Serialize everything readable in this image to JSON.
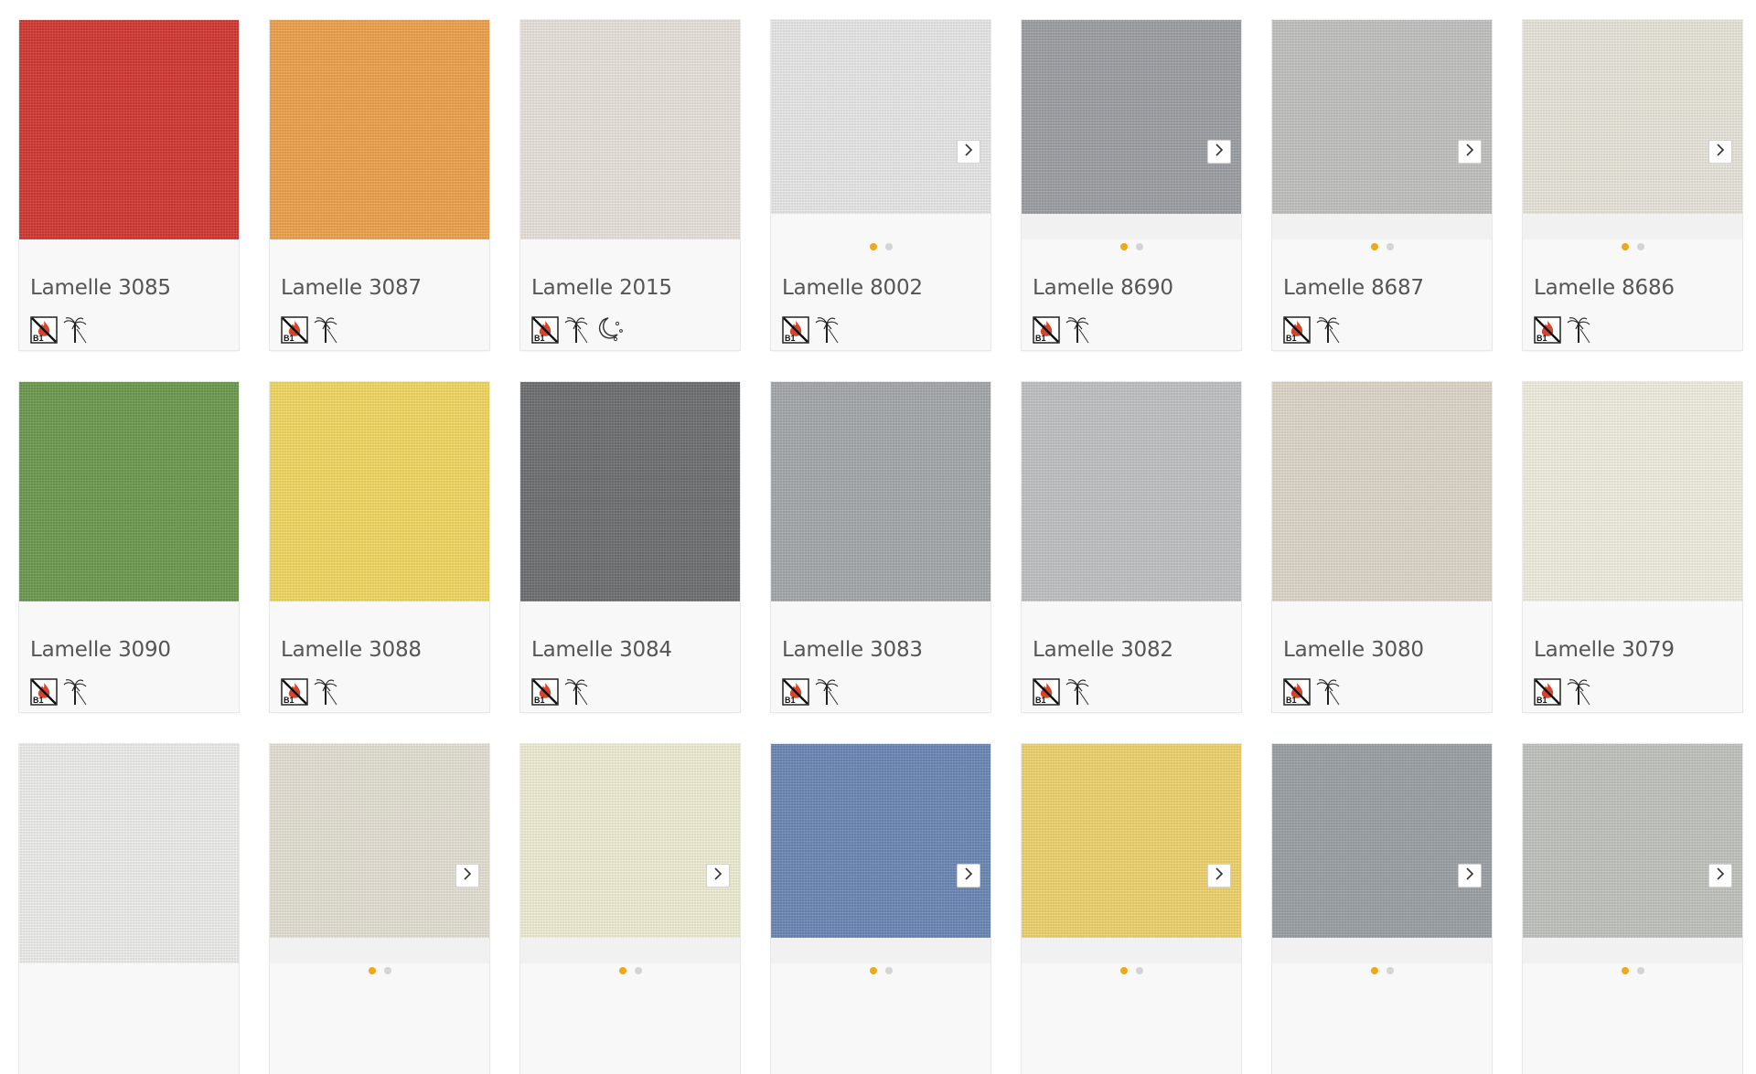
{
  "products": [
    {
      "name": "Lamelle 3085",
      "color": "#d53a33",
      "slider": false,
      "icons": [
        "fire-b1-icon",
        "palm-tree-icon"
      ]
    },
    {
      "name": "Lamelle 3087",
      "color": "#f0a44f",
      "slider": false,
      "icons": [
        "fire-b1-icon",
        "palm-tree-icon"
      ]
    },
    {
      "name": "Lamelle 2015",
      "color": "#ebe5de",
      "slider": false,
      "icons": [
        "fire-b1-icon",
        "palm-tree-icon",
        "moon-stars-icon"
      ]
    },
    {
      "name": "Lamelle 8002",
      "color": "#eaeaea",
      "slider": true,
      "icons": [
        "fire-b1-icon",
        "palm-tree-icon"
      ]
    },
    {
      "name": "Lamelle 8690",
      "color": "#9ea2a6",
      "slider": true,
      "icons": [
        "fire-b1-icon",
        "palm-tree-icon"
      ]
    },
    {
      "name": "Lamelle 8687",
      "color": "#c4c4c3",
      "slider": true,
      "icons": [
        "fire-b1-icon",
        "palm-tree-icon"
      ]
    },
    {
      "name": "Lamelle 8686",
      "color": "#ebe8dd",
      "slider": true,
      "icons": [
        "fire-b1-icon",
        "palm-tree-icon"
      ]
    },
    {
      "name": "Lamelle 3090",
      "color": "#6f9d52",
      "slider": false,
      "icons": [
        "fire-b1-icon",
        "palm-tree-icon"
      ]
    },
    {
      "name": "Lamelle 3088",
      "color": "#f5da64",
      "slider": false,
      "icons": [
        "fire-b1-icon",
        "palm-tree-icon"
      ]
    },
    {
      "name": "Lamelle 3084",
      "color": "#707274",
      "slider": false,
      "icons": [
        "fire-b1-icon",
        "palm-tree-icon"
      ]
    },
    {
      "name": "Lamelle 3083",
      "color": "#a7abae",
      "slider": false,
      "icons": [
        "fire-b1-icon",
        "palm-tree-icon"
      ]
    },
    {
      "name": "Lamelle 3082",
      "color": "#c3c4c5",
      "slider": false,
      "icons": [
        "fire-b1-icon",
        "palm-tree-icon"
      ]
    },
    {
      "name": "Lamelle 3080",
      "color": "#e0dacb",
      "slider": false,
      "icons": [
        "fire-b1-icon",
        "palm-tree-icon"
      ]
    },
    {
      "name": "Lamelle 3079",
      "color": "#f3f0e3",
      "slider": false,
      "icons": [
        "fire-b1-icon",
        "palm-tree-icon"
      ]
    },
    {
      "name": "",
      "color": "#f0f0ee",
      "slider": false,
      "icons": []
    },
    {
      "name": "",
      "color": "#e7e3d6",
      "slider": true,
      "icons": []
    },
    {
      "name": "",
      "color": "#f3f0d6",
      "slider": true,
      "icons": []
    },
    {
      "name": "",
      "color": "#6e8ab7",
      "slider": true,
      "icons": []
    },
    {
      "name": "",
      "color": "#f1d66f",
      "slider": true,
      "icons": []
    },
    {
      "name": "",
      "color": "#9ea3a8",
      "slider": true,
      "icons": []
    },
    {
      "name": "",
      "color": "#c4c6c1",
      "slider": true,
      "icons": []
    }
  ],
  "ui": {
    "dot_active_color": "#f0a818",
    "dot_inactive_color": "#d4d4d4",
    "next_icon": "chevron-right-icon",
    "fire_badge_text": "B1"
  }
}
